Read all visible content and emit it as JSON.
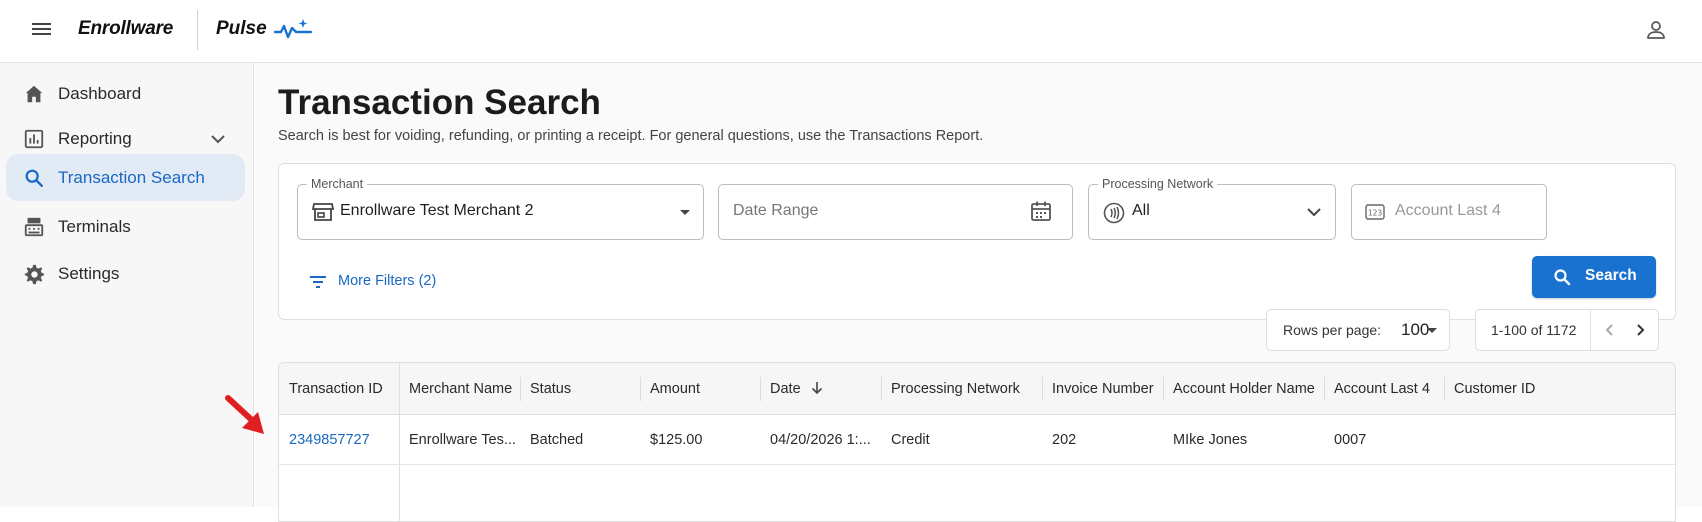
{
  "app": {
    "brand": "Enrollware",
    "product": "Pulse"
  },
  "sidebar": {
    "items": [
      {
        "label": "Dashboard",
        "icon": "home-icon"
      },
      {
        "label": "Reporting",
        "icon": "bar-chart-icon"
      },
      {
        "label": "Transaction Search",
        "icon": "search-icon",
        "active": true
      },
      {
        "label": "Terminals",
        "icon": "terminal-icon"
      },
      {
        "label": "Settings",
        "icon": "gear-icon"
      }
    ]
  },
  "page": {
    "title": "Transaction Search",
    "subtitle": "Search is best for voiding, refunding, or printing a receipt. For general questions, use the Transactions Report."
  },
  "filters": {
    "merchant": {
      "label": "Merchant",
      "value": "Enrollware Test Merchant 2"
    },
    "date_range": {
      "placeholder": "Date Range"
    },
    "network": {
      "label": "Processing Network",
      "value": "All"
    },
    "account_last4": {
      "placeholder": "Account Last 4"
    },
    "more_filters": "More Filters (2)",
    "search_button": "Search"
  },
  "pagination": {
    "rows_per_page_label": "Rows per page:",
    "rows_per_page": "100",
    "range": "1-100 of 1172"
  },
  "table": {
    "columns": [
      "Transaction ID",
      "Merchant Name",
      "Status",
      "Amount",
      "Date",
      "Processing Network",
      "Invoice Number",
      "Account Holder Name",
      "Account Last 4",
      "Customer ID"
    ],
    "rows": [
      [
        "2349857727",
        "Enrollware Tes...",
        "Batched",
        "$125.00",
        "04/20/2026 1:...",
        "Credit",
        "202",
        "MIke Jones",
        "0007",
        ""
      ]
    ]
  },
  "colors": {
    "accent": "#1a72d0",
    "link": "#1868c4",
    "active_nav_bg": "#e2ebf5",
    "annotation_arrow": "#e02020"
  }
}
